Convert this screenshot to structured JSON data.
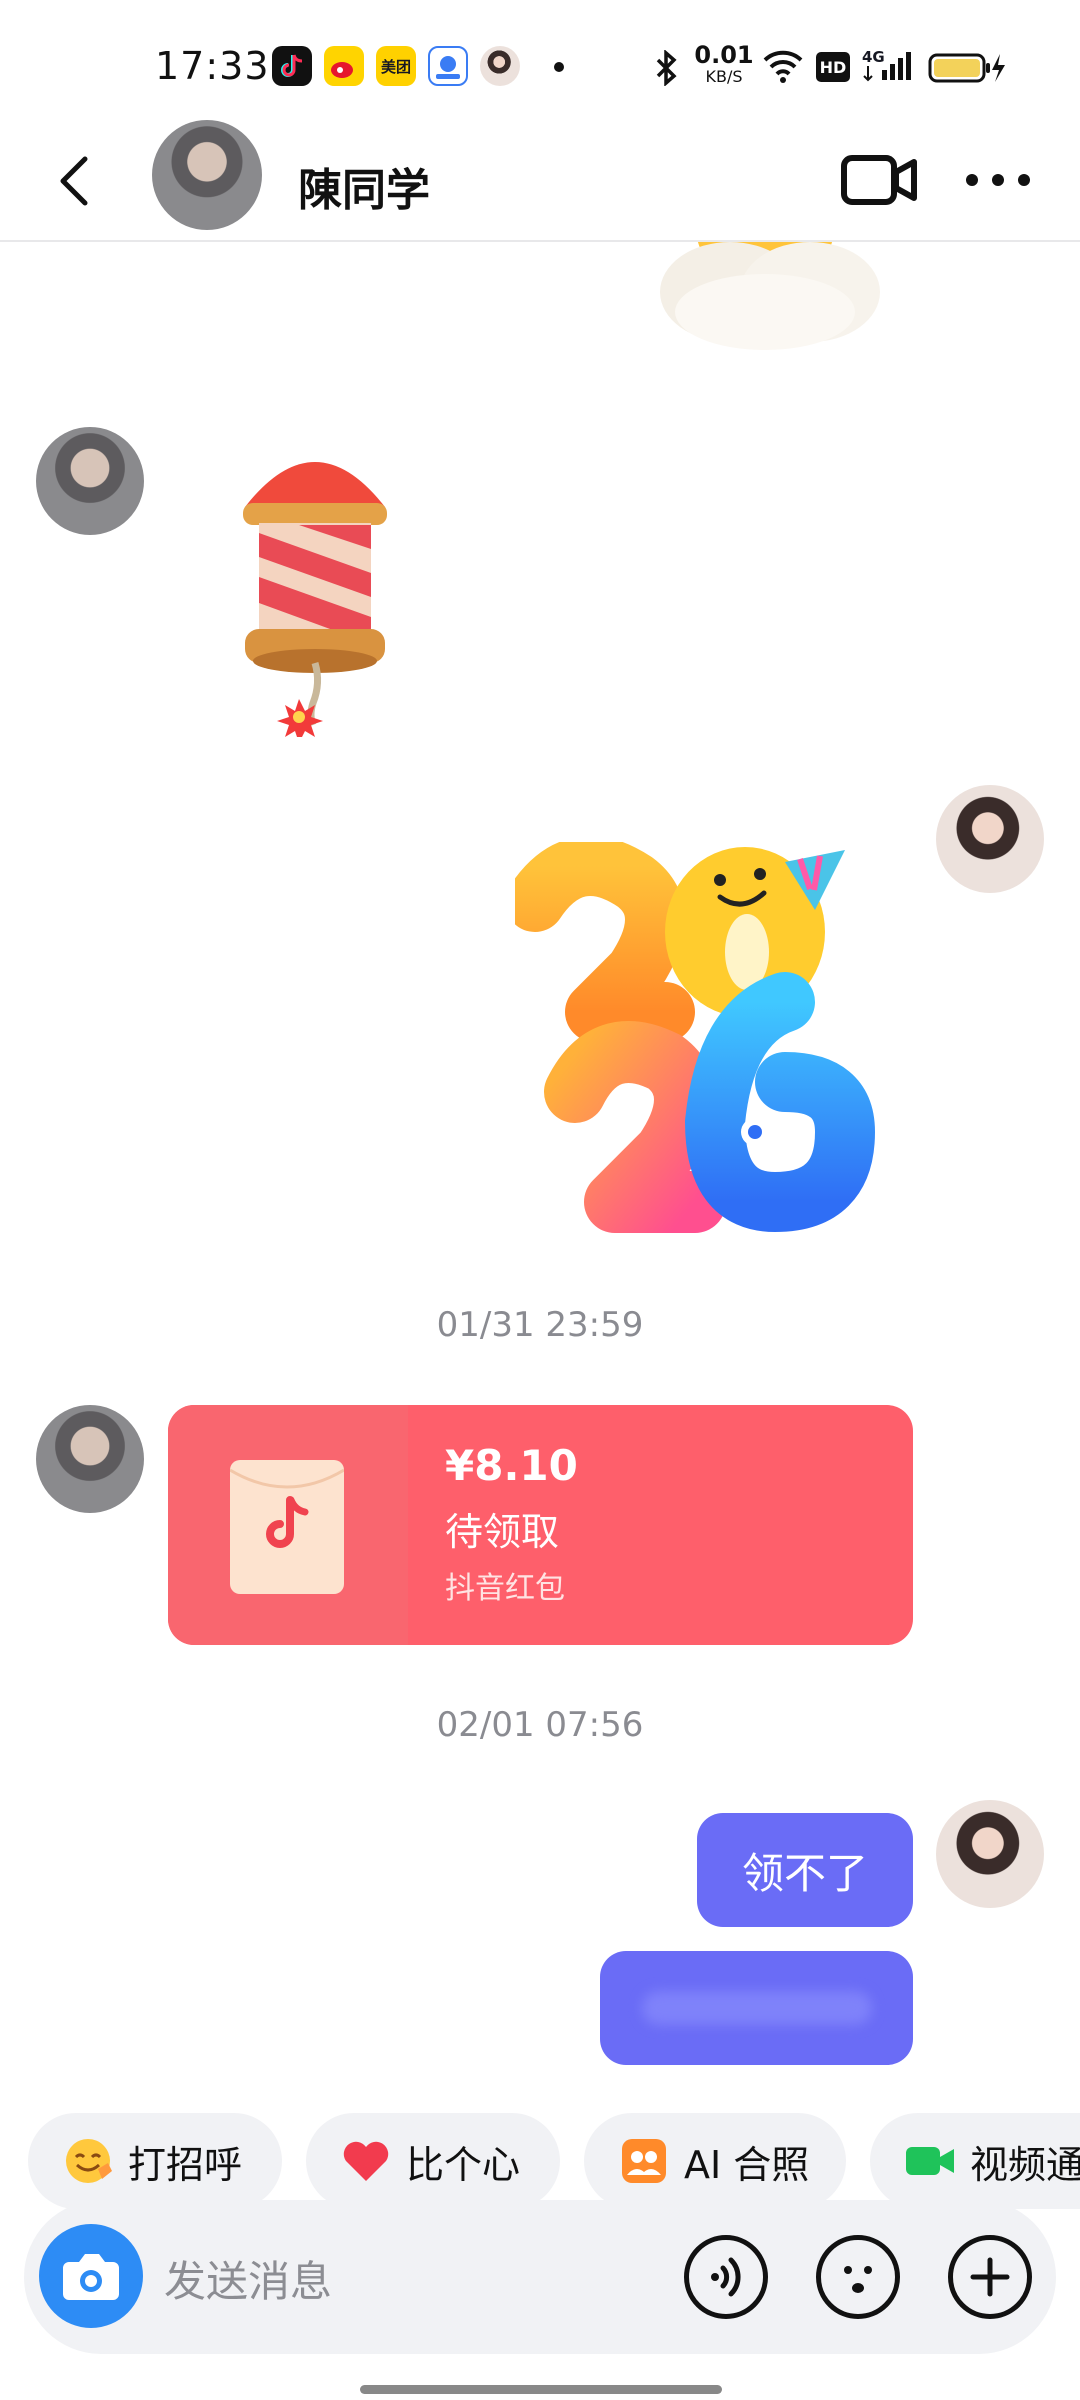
{
  "status_bar": {
    "time": "17:33",
    "net_speed_value": "0.01",
    "net_speed_unit": "KB/S",
    "hd": "HD",
    "network": "4G",
    "app_icons": [
      "douyin-icon",
      "weibo-icon",
      "meituan-icon",
      "baidu-map-icon",
      "avatar-app-icon"
    ],
    "meituan_text": "美团"
  },
  "header": {
    "contact_name": "陳同学"
  },
  "messages": {
    "timestamp_1": "01/31 23:59",
    "red_packet": {
      "amount": "¥8.10",
      "status": "待领取",
      "label": "抖音红包"
    },
    "timestamp_2": "02/01 07:56",
    "reply_1": "领不了"
  },
  "quick_replies": [
    {
      "label": "打招呼",
      "icon": "wave-emoji-icon"
    },
    {
      "label": "比个心",
      "icon": "heart-icon"
    },
    {
      "label": "AI 合照",
      "icon": "ai-photo-icon"
    },
    {
      "label": "视频通",
      "icon": "video-call-icon"
    }
  ],
  "input": {
    "placeholder": "发送消息"
  },
  "colors": {
    "red_packet": "#fe5f6b",
    "bubble": "#6a6cf6",
    "camera": "#2d8cf5"
  }
}
